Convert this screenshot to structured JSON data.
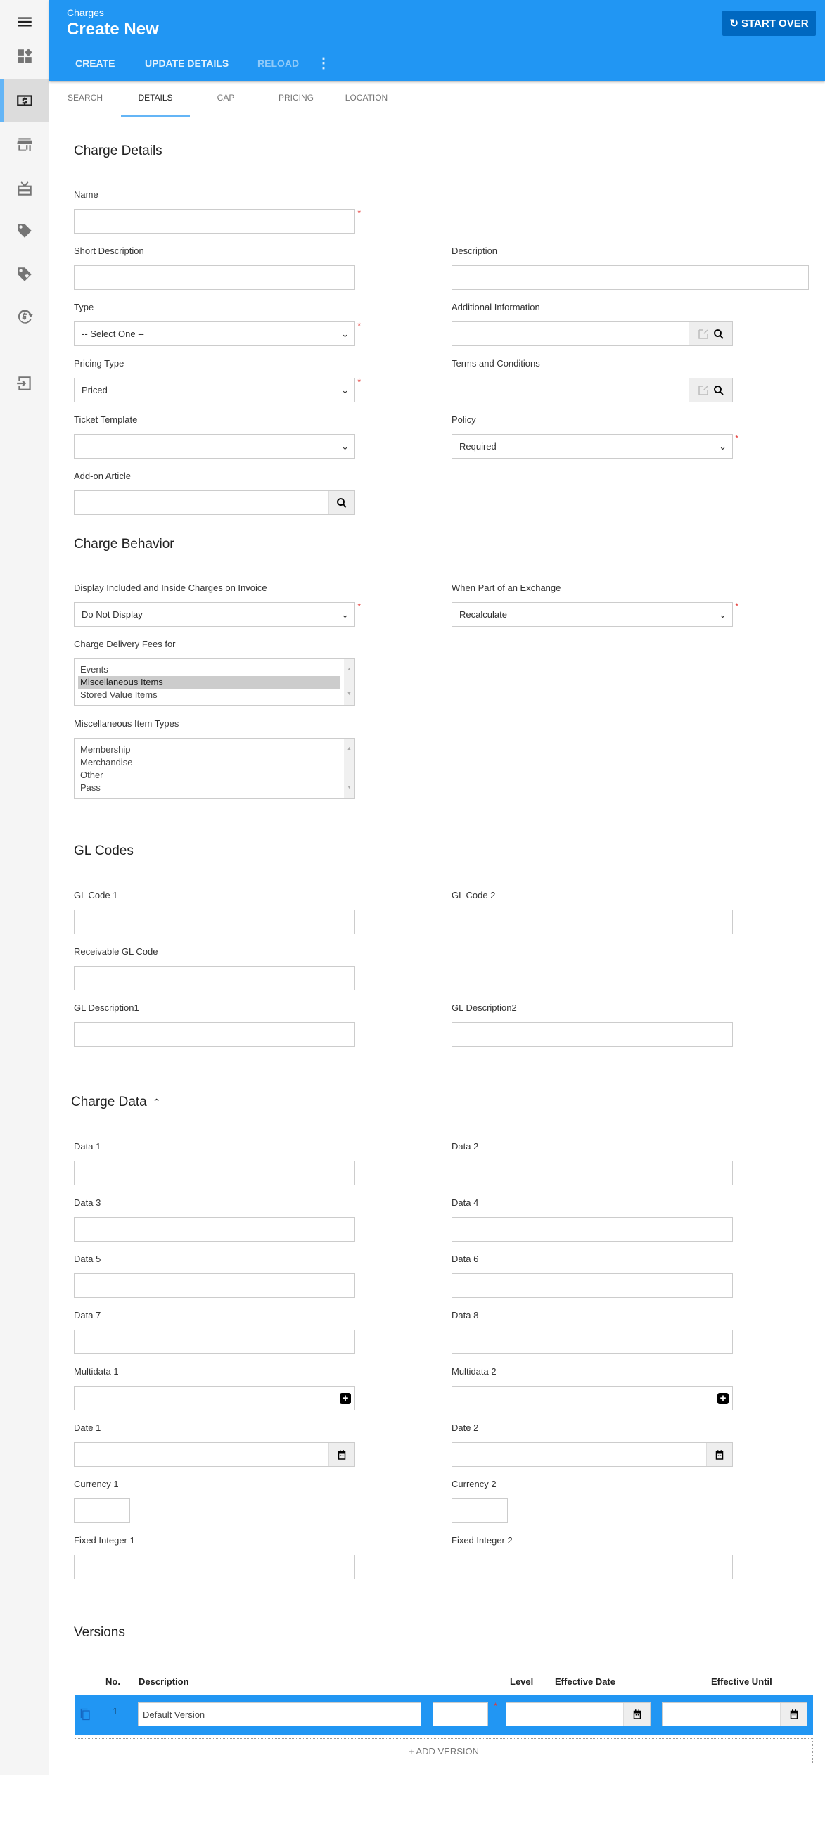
{
  "colors": {
    "primary": "#2196f3",
    "start_over_bg": "#0068c0",
    "accent": "#64b5f6",
    "required": "#e53935"
  },
  "sidebar": {
    "items": [
      {
        "icon": "menu-icon"
      },
      {
        "icon": "dashboard-icon"
      },
      {
        "icon": "charges-dollar-icon",
        "active": true
      },
      {
        "icon": "store-icon"
      },
      {
        "icon": "gift-card-icon"
      },
      {
        "icon": "tag-icon"
      },
      {
        "icon": "tag-heart-icon"
      },
      {
        "icon": "currency-exchange-icon"
      },
      {
        "icon": "exit-to-app-icon"
      }
    ]
  },
  "header": {
    "breadcrumb": "Charges",
    "title": "Create New",
    "start_over": "START OVER",
    "toolbar": {
      "create": "CREATE",
      "update_details": "UPDATE DETAILS",
      "reload": "RELOAD"
    }
  },
  "tabs": [
    "SEARCH",
    "DETAILS",
    "CAP",
    "PRICING",
    "LOCATION"
  ],
  "active_tab": "DETAILS",
  "details": {
    "heading": "Charge Details",
    "name": {
      "label": "Name",
      "value": ""
    },
    "short_description": {
      "label": "Short Description",
      "value": ""
    },
    "description": {
      "label": "Description",
      "value": ""
    },
    "type": {
      "label": "Type",
      "value": "-- Select One --"
    },
    "additional_information": {
      "label": "Additional Information",
      "value": ""
    },
    "pricing_type": {
      "label": "Pricing Type",
      "value": "Priced"
    },
    "terms": {
      "label": "Terms and Conditions",
      "value": ""
    },
    "ticket_template": {
      "label": "Ticket Template",
      "value": ""
    },
    "policy": {
      "label": "Policy",
      "value": "Required"
    },
    "addon_article": {
      "label": "Add-on Article",
      "value": ""
    }
  },
  "behavior": {
    "heading": "Charge Behavior",
    "display_included": {
      "label": "Display Included and Inside Charges on Invoice",
      "value": "Do Not Display"
    },
    "exchange": {
      "label": "When Part of an Exchange",
      "value": "Recalculate"
    },
    "delivery_fees": {
      "label": "Charge Delivery Fees for",
      "options": [
        "Events",
        "Miscellaneous Items",
        "Stored Value Items"
      ],
      "selected": "Miscellaneous Items"
    },
    "misc_types": {
      "label": "Miscellaneous Item Types",
      "options": [
        "Membership",
        "Merchandise",
        "Other",
        "Pass"
      ]
    }
  },
  "gl": {
    "heading": "GL Codes",
    "code1": "GL Code 1",
    "code2": "GL Code 2",
    "receivable": "Receivable GL Code",
    "desc1": "GL Description1",
    "desc2": "GL Description2"
  },
  "charge_data": {
    "heading": "Charge Data",
    "expanded": true,
    "labels": [
      "Data 1",
      "Data 2",
      "Data 3",
      "Data 4",
      "Data 5",
      "Data 6",
      "Data 7",
      "Data 8",
      "Multidata 1",
      "Multidata 2",
      "Date 1",
      "Date 2",
      "Currency 1",
      "Currency 2",
      "Fixed Integer 1",
      "Fixed Integer 2"
    ]
  },
  "versions": {
    "heading": "Versions",
    "columns": [
      "No.",
      "Description",
      "Level",
      "Effective Date",
      "Effective Until"
    ],
    "rows": [
      {
        "no": "1",
        "description": "Default Version",
        "level": "",
        "effective_date": "",
        "effective_until": ""
      }
    ],
    "add_label": "+ ADD VERSION"
  }
}
